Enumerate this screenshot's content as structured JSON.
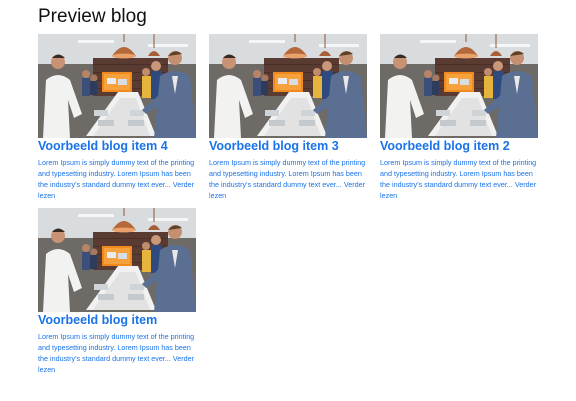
{
  "page": {
    "title": "Preview blog"
  },
  "colors": {
    "link": "#1a73e8",
    "text": "#111111"
  },
  "posts": [
    {
      "title": "Voorbeeld blog item 4",
      "excerpt": "Lorem Ipsum is simply dummy text of the printing and typesetting industry. Lorem Ipsum has been the industry's standard dummy text ever...",
      "read_more": "Verder lezen",
      "image_icon": "team-laptops-photo"
    },
    {
      "title": "Voorbeeld blog item 3",
      "excerpt": "Lorem Ipsum is simply dummy text of the printing and typesetting industry. Lorem Ipsum has been the industry's standard dummy text ever...",
      "read_more": "Verder lezen",
      "image_icon": "team-laptops-photo"
    },
    {
      "title": "Voorbeeld blog item 2",
      "excerpt": "Lorem Ipsum is simply dummy text of the printing and typesetting industry. Lorem Ipsum has been the industry's standard dummy text ever...",
      "read_more": "Verder lezen",
      "image_icon": "team-laptops-photo"
    },
    {
      "title": "Voorbeeld blog item",
      "excerpt": "Lorem Ipsum is simply dummy text of the printing and typesetting industry. Lorem Ipsum has been the industry's standard dummy text ever...",
      "read_more": "Verder lezen",
      "image_icon": "team-laptops-photo"
    }
  ]
}
